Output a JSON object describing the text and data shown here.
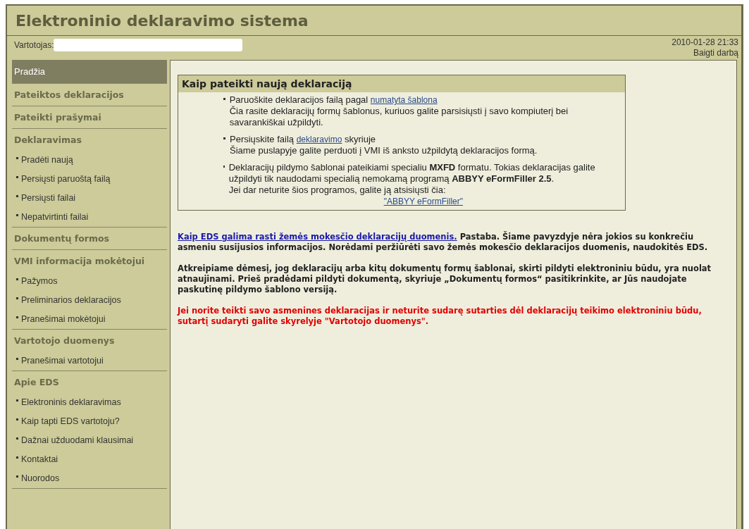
{
  "header": {
    "title": "Elektroninio deklaravimo sistema"
  },
  "user_bar": {
    "label": "Vartotojas:",
    "datetime": "2010-01-28 21:33",
    "logout": "Baigti darbą"
  },
  "sidebar": {
    "items": [
      {
        "kind": "section",
        "label": "Pradžia",
        "selected": true
      },
      {
        "kind": "section",
        "label": "Pateiktos deklaracijos",
        "selected": false
      },
      {
        "kind": "section",
        "label": "Pateikti prašymai",
        "selected": false
      },
      {
        "kind": "section",
        "label": "Deklaravimas",
        "selected": false,
        "children": [
          {
            "label": "Pradėti naują",
            "selected": false
          },
          {
            "label": "Persiųsti paruoštą failą",
            "selected": false
          },
          {
            "label": "Persiųsti failai",
            "selected": false
          },
          {
            "label": "Nepatvirtinti failai",
            "selected": false
          }
        ]
      },
      {
        "kind": "section",
        "label": "Dokumentų formos",
        "selected": false
      },
      {
        "kind": "section",
        "label": "VMI informacija mokėtojui",
        "selected": false,
        "children": [
          {
            "label": "Pažymos",
            "selected": false
          },
          {
            "label": "Preliminarios deklaracijos",
            "selected": false
          },
          {
            "label": "Pranešimai mokėtojui",
            "selected": false
          }
        ]
      },
      {
        "kind": "section",
        "label": "Vartotojo duomenys",
        "selected": false,
        "children": [
          {
            "label": "Pranešimai vartotojui",
            "selected": false
          }
        ]
      },
      {
        "kind": "section",
        "label": "Apie EDS",
        "selected": false,
        "children": [
          {
            "label": "Elektroninis deklaravimas",
            "selected": false
          },
          {
            "label": "Kaip tapti EDS vartotoju?",
            "selected": false
          },
          {
            "label": "Dažnai užduodami klausimai",
            "selected": false
          },
          {
            "label": "Kontaktai",
            "selected": false
          },
          {
            "label": "Nuorodos",
            "selected": false
          }
        ]
      }
    ]
  },
  "info_box": {
    "title": "Kaip pateikti naują deklaraciją",
    "bullets": [
      {
        "paragraphs": [
          {
            "segments": [
              {
                "kind": "text",
                "text": "Paruoškite deklaracijos failą pagal "
              },
              {
                "kind": "link",
                "text": "numatyta šablona"
              }
            ]
          },
          {
            "segments": [
              {
                "kind": "text",
                "text": "Čia rasite deklaracijų formų šablonus, kuriuos galite parsisiųsti į savo kompiuterį bei savarankiškai užpildyti."
              }
            ]
          }
        ]
      },
      {
        "paragraphs": [
          {
            "segments": [
              {
                "kind": "text",
                "text": "Persiųskite failą "
              },
              {
                "kind": "link",
                "text": "deklaravimo"
              },
              {
                "kind": "text",
                "text": " skyriuje"
              }
            ]
          },
          {
            "segments": [
              {
                "kind": "text",
                "text": "Šiame puslapyje galite perduoti į VMI iš anksto užpildytą deklaracijos formą."
              }
            ]
          }
        ]
      },
      {
        "paragraphs": [
          {
            "segments": [
              {
                "kind": "text",
                "text": "Deklaracijų pildymo šablonai pateikiami specialiu **MXFD** formatu. Tokias deklaracijas galite užpildyti tik naudodami specialią nemokamą programą **ABBYY eFormFiller 2.5**."
              }
            ]
          },
          {
            "segments": [
              {
                "kind": "text",
                "text": "Jei dar neturite šios programos, galite ją atsisiųsti čia:"
              }
            ]
          },
          {
            "centered": true,
            "segments": [
              {
                "kind": "link",
                "text": "\"ABBYY eFormFiller\""
              }
            ]
          }
        ]
      }
    ]
  },
  "notes": [
    {
      "kind": "normal",
      "segments": [
        {
          "kind": "link",
          "text": "Kaip EDS galima rasti žemės mokesčio deklaracijų duomenis."
        },
        {
          "kind": "text",
          "text": " Pastaba. Šiame pavyzdyje nėra jokios su konkrečiu asmeniu susijusios informacijos. Norėdami peržiūrėti savo žemės mokesčio deklaracijos duomenis, naudokitės EDS."
        }
      ]
    },
    {
      "kind": "normal",
      "segments": [
        {
          "kind": "text",
          "text": "Atkreipiame dėmesį, jog deklaracijų arba kitų dokumentų formų šablonai, skirti pildyti elektroniniu būdu, yra nuolat atnaujinami. Prieš pradėdami pildyti dokumentą, skyriuje „Dokumentų formos“ pasitikrinkite, ar Jūs naudojate paskutinę pildymo šablono versiją."
        }
      ]
    },
    {
      "kind": "warning",
      "segments": [
        {
          "kind": "text",
          "text": "Jei norite teikti savo asmenines deklaracijas ir neturite sudarę sutarties dėl deklaracijų teikimo elektroniniu būdu, sutartį sudaryti galite skyrelyje \"Vartotojo duomenys\"."
        }
      ]
    }
  ]
}
